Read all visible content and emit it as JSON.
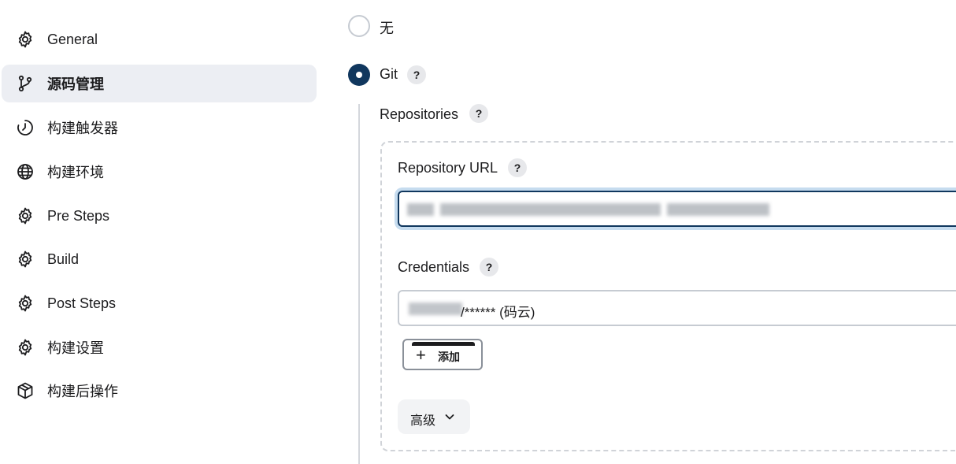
{
  "sidebar": {
    "items": [
      {
        "label": "General",
        "icon": "gear-icon"
      },
      {
        "label": "源码管理",
        "icon": "git-branch-icon",
        "active": true
      },
      {
        "label": "构建触发器",
        "icon": "timer-icon"
      },
      {
        "label": "构建环境",
        "icon": "globe-icon"
      },
      {
        "label": "Pre Steps",
        "icon": "gear-icon"
      },
      {
        "label": "Build",
        "icon": "gear-icon"
      },
      {
        "label": "Post Steps",
        "icon": "gear-icon"
      },
      {
        "label": "构建设置",
        "icon": "gear-icon"
      },
      {
        "label": "构建后操作",
        "icon": "package-icon"
      }
    ]
  },
  "scm": {
    "none_label": "无",
    "git_label": "Git",
    "help": "?",
    "repositories_label": "Repositories",
    "repo_url_label": "Repository URL",
    "credentials_label": "Credentials",
    "credentials_value": "/****** (码云)",
    "add_button": "添加",
    "add_icon": "+",
    "advanced_button": "高级"
  },
  "colors": {
    "accent": "#10375e",
    "active_nav_bg": "#eceef3",
    "focus_ring": "#c6dcef"
  }
}
